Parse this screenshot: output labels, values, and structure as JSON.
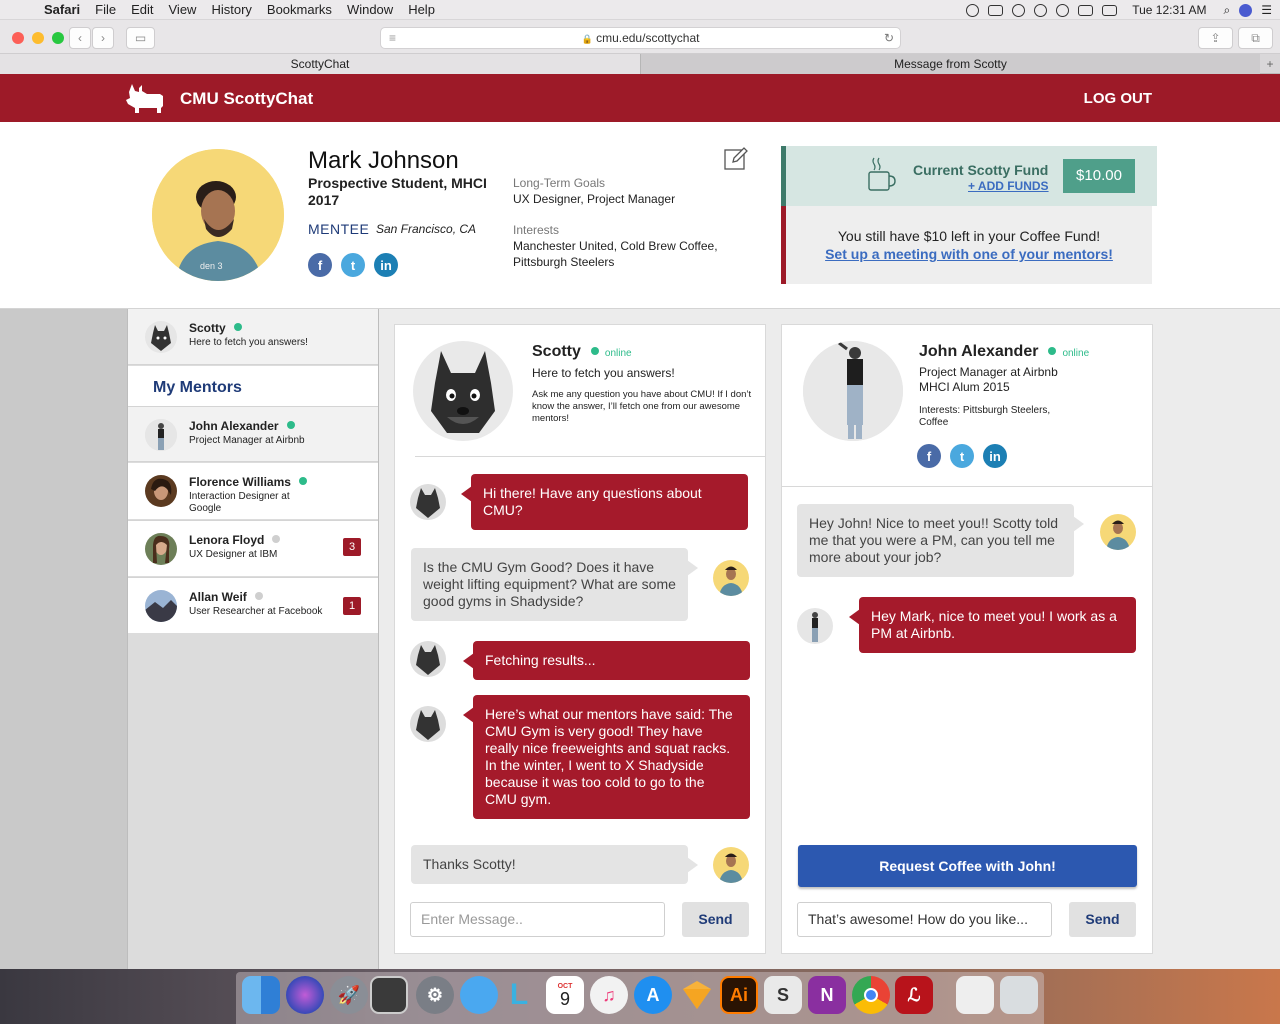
{
  "menubar": {
    "app": "Safari",
    "items": [
      "File",
      "Edit",
      "View",
      "History",
      "Bookmarks",
      "Window",
      "Help"
    ],
    "clock": "Tue 12:31 AM"
  },
  "browser": {
    "url": "cmu.edu/scottychat",
    "tabs": [
      "ScottyChat",
      "Message from Scotty"
    ]
  },
  "app": {
    "name": "CMU ScottyChat",
    "logout": "LOG OUT",
    "brand_color": "#9d1a28"
  },
  "profile": {
    "name": "Mark Johnson",
    "title": "Prospective Student, MHCI 2017",
    "role": "MENTEE",
    "location": "San Francisco, CA",
    "goals_label": "Long-Term Goals",
    "goals": "UX Designer, Project Manager",
    "interests_label": "Interests",
    "interests": "Manchester United, Cold Brew Coffee, Pittsburgh Steelers",
    "social": [
      "f",
      "t",
      "in"
    ]
  },
  "fund": {
    "label": "Current Scotty Fund",
    "add_funds": "+ ADD FUNDS",
    "amount": "$10.00",
    "message": "You still have $10 left in your Coffee Fund!",
    "link": "Set up a meeting with one of your mentors!"
  },
  "sidebar": {
    "scotty": {
      "name": "Scotty",
      "sub": "Here to fetch you answers!"
    },
    "mentors_heading": "My Mentors",
    "mentors": [
      {
        "name": "John Alexander",
        "sub": "Project Manager at Airbnb",
        "status": "online"
      },
      {
        "name": "Florence Williams",
        "sub": "Interaction Designer at Google",
        "status": "online"
      },
      {
        "name": "Lenora Floyd",
        "sub": "UX Designer at IBM",
        "status": "offline",
        "badge": "3"
      },
      {
        "name": "Allan Weif",
        "sub": "User Researcher at Facebook",
        "status": "offline",
        "badge": "1"
      }
    ]
  },
  "scotty_chat": {
    "name": "Scotty",
    "status": "online",
    "tagline": "Here to fetch you answers!",
    "desc": "Ask me any question you have about CMU! If I don’t know the answer, I’ll fetch one from our awesome mentors!",
    "messages": [
      {
        "from": "scotty",
        "text": "Hi there! Have any questions about CMU?"
      },
      {
        "from": "me",
        "text": "Is the CMU Gym Good? Does it have weight lifting equipment? What are some good gyms in Shadyside?"
      },
      {
        "from": "scotty",
        "text": "Fetching results..."
      },
      {
        "from": "scotty",
        "text": "Here’s what our mentors have said: The CMU Gym is very good! They have really nice freeweights and squat racks. In the winter, I went to X Shadyside because it was too cold to go to the CMU gym."
      },
      {
        "from": "me",
        "text": "Thanks Scotty!"
      }
    ],
    "input_placeholder": "Enter Message..",
    "send": "Send"
  },
  "mentor_chat": {
    "name": "John Alexander",
    "status": "online",
    "title": "Project Manager at Airbnb",
    "alum": "MHCI Alum 2015",
    "interests": "Interests: Pittsburgh Steelers, Coffee",
    "social": [
      "f",
      "t",
      "in"
    ],
    "messages": [
      {
        "from": "me",
        "text": "Hey John! Nice to meet you!! Scotty told me that you were a PM, can you tell me more about your job?"
      },
      {
        "from": "john",
        "text": "Hey Mark, nice to meet you! I work as a PM at Airbnb."
      }
    ],
    "request_button": "Request Coffee with John!",
    "input_value": "That’s awesome! How do you like...",
    "send": "Send"
  },
  "dock": {
    "apps": [
      "finder-icon",
      "siri-icon",
      "launchpad-icon",
      "photo-icon",
      "system-preferences-icon",
      "messages-icon",
      "lynda-icon",
      "calendar-icon",
      "itunes-icon",
      "app-store-icon",
      "sketch-icon",
      "illustrator-icon",
      "scrivener-icon",
      "onenote-icon",
      "chrome-icon",
      "acrobat-icon",
      "downloads-icon",
      "trash-icon"
    ],
    "calendar_month": "OCT",
    "calendar_day": "9",
    "illustrator": "Ai",
    "scrivener": "S",
    "onenote": "N"
  }
}
